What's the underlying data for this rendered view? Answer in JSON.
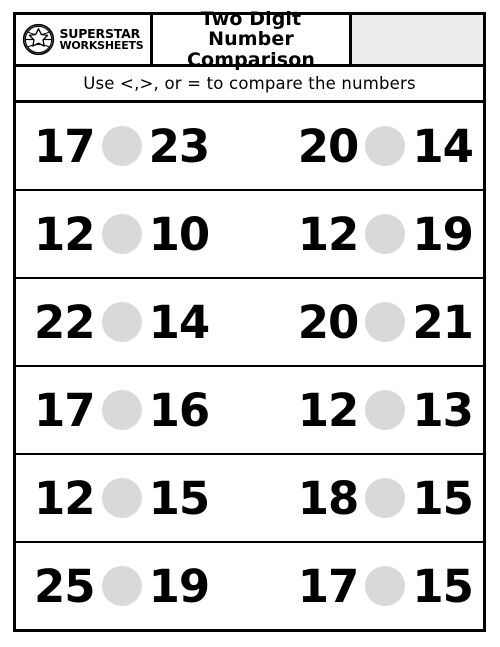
{
  "header": {
    "logo": {
      "icon": "globe-star-icon",
      "line1": "SUPERSTAR",
      "line2": "WORKSHEETS"
    },
    "title": "Two Digit Number Comparison",
    "name_box_value": "",
    "name_box_color": "#ededed"
  },
  "instruction": "Use <,>, or = to compare the numbers",
  "colors": {
    "border": "#000000",
    "answer_circle": "#d9d9d9",
    "text": "#000000",
    "page": "#ffffff"
  },
  "rows": [
    {
      "left": {
        "a": "17",
        "answer": "",
        "b": "23"
      },
      "right": {
        "a": "20",
        "answer": "",
        "b": "14"
      }
    },
    {
      "left": {
        "a": "12",
        "answer": "",
        "b": "10"
      },
      "right": {
        "a": "12",
        "answer": "",
        "b": "19"
      }
    },
    {
      "left": {
        "a": "22",
        "answer": "",
        "b": "14"
      },
      "right": {
        "a": "20",
        "answer": "",
        "b": "21"
      }
    },
    {
      "left": {
        "a": "17",
        "answer": "",
        "b": "16"
      },
      "right": {
        "a": "12",
        "answer": "",
        "b": "13"
      }
    },
    {
      "left": {
        "a": "12",
        "answer": "",
        "b": "15"
      },
      "right": {
        "a": "18",
        "answer": "",
        "b": "15"
      }
    },
    {
      "left": {
        "a": "25",
        "answer": "",
        "b": "19"
      },
      "right": {
        "a": "17",
        "answer": "",
        "b": "15"
      }
    }
  ]
}
